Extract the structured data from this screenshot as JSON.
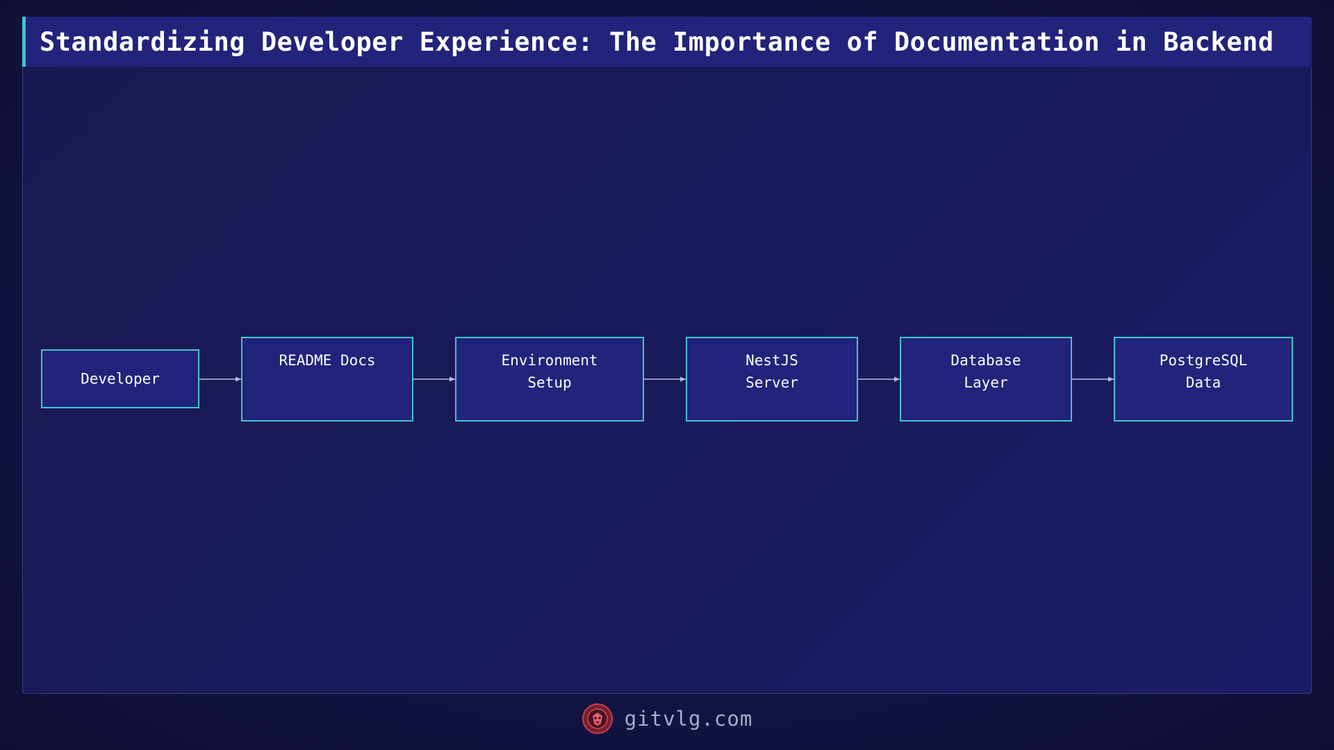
{
  "header": {
    "title": "Standardizing Developer Experience: The Importance of Documentation in Backend …"
  },
  "diagram": {
    "nodes": [
      {
        "id": "developer",
        "lines": [
          "Developer"
        ]
      },
      {
        "id": "readme-docs",
        "lines": [
          "README Docs"
        ]
      },
      {
        "id": "environment-setup",
        "lines": [
          "Environment",
          "Setup"
        ]
      },
      {
        "id": "nestjs-server",
        "lines": [
          "NestJS",
          "Server"
        ]
      },
      {
        "id": "database-layer",
        "lines": [
          "Database",
          "Layer"
        ]
      },
      {
        "id": "postgresql-data",
        "lines": [
          "PostgreSQL",
          "Data"
        ]
      }
    ],
    "edges": [
      {
        "from": "developer",
        "to": "readme-docs"
      },
      {
        "from": "readme-docs",
        "to": "environment-setup"
      },
      {
        "from": "environment-setup",
        "to": "nestjs-server"
      },
      {
        "from": "nestjs-server",
        "to": "database-layer"
      },
      {
        "from": "database-layer",
        "to": "postgresql-data"
      }
    ],
    "colors": {
      "node_fill": "#22237a",
      "node_border": "#3fc6cf",
      "edge": "#b8bfe0",
      "text": "#ffffff"
    }
  },
  "footer": {
    "logo_icon": "lion-logo-icon",
    "text": "gitvlg.com"
  }
}
